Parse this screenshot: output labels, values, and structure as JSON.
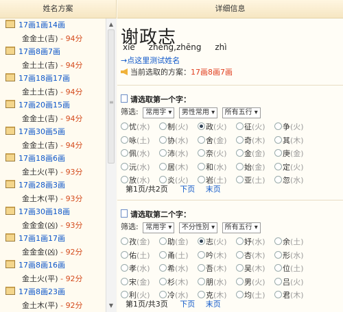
{
  "left_header": "姓名方案",
  "right_header": "详细信息",
  "list": [
    {
      "combo": "17画1画14画",
      "rating": "金金土(吉)",
      "score": "94分"
    },
    {
      "combo": "17画8画7画",
      "rating": "金土土(吉)",
      "score": "94分"
    },
    {
      "combo": "17画18画17画",
      "rating": "金土土(吉)",
      "score": "94分"
    },
    {
      "combo": "17画20画15画",
      "rating": "金金土(吉)",
      "score": "94分"
    },
    {
      "combo": "17画30画5画",
      "rating": "金金土(吉)",
      "score": "94分"
    },
    {
      "combo": "17画18画6画",
      "rating": "金土火(平)",
      "score": "93分"
    },
    {
      "combo": "17画28画3画",
      "rating": "金土木(平)",
      "score": "93分"
    },
    {
      "combo": "17画30画18画",
      "rating": "金金金(凶)",
      "score": "93分"
    },
    {
      "combo": "17画1画17画",
      "rating": "金金金(凶)",
      "score": "92分"
    },
    {
      "combo": "17画8画16画",
      "rating": "金土火(平)",
      "score": "92分"
    },
    {
      "combo": "17画8画23画",
      "rating": "金土木(平)",
      "score": "92分"
    },
    {
      "combo": "17画8画27画",
      "rating": "",
      "score": ""
    }
  ],
  "name": "谢政志",
  "pinyin": [
    "xiè",
    "zhèng,zhēng",
    "zhì"
  ],
  "test_link": "→点这里测试姓名",
  "current_label": "当前选取的方案：",
  "current_value": "17画8画7画",
  "section1": {
    "title": "请选取第一个字：",
    "filter_label": "筛选:",
    "dropdowns": [
      "常用字 ▾",
      "男性常用 ▾",
      "所有五行 ▾"
    ],
    "chars": [
      {
        "c": "忧",
        "e": "(水)"
      },
      {
        "c": "制",
        "e": "(火)"
      },
      {
        "c": "政",
        "e": "(火)",
        "on": true
      },
      {
        "c": "征",
        "e": "(火)"
      },
      {
        "c": "争",
        "e": "(火)"
      },
      {
        "c": "咏",
        "e": "(土)"
      },
      {
        "c": "协",
        "e": "(水)"
      },
      {
        "c": "舍",
        "e": "(金)"
      },
      {
        "c": "奇",
        "e": "(木)"
      },
      {
        "c": "其",
        "e": "(木)"
      },
      {
        "c": "佩",
        "e": "(水)"
      },
      {
        "c": "沛",
        "e": "(水)"
      },
      {
        "c": "奈",
        "e": "(火)"
      },
      {
        "c": "金",
        "e": "(金)"
      },
      {
        "c": "庚",
        "e": "(金)"
      },
      {
        "c": "沅",
        "e": "(水)"
      },
      {
        "c": "居",
        "e": "(木)"
      },
      {
        "c": "和",
        "e": "(水)"
      },
      {
        "c": "始",
        "e": "(金)"
      },
      {
        "c": "定",
        "e": "(火)"
      },
      {
        "c": "放",
        "e": "(水)"
      },
      {
        "c": "炎",
        "e": "(火)"
      },
      {
        "c": "岩",
        "e": "(土)"
      },
      {
        "c": "亚",
        "e": "(土)"
      },
      {
        "c": "忽",
        "e": "(水)"
      }
    ],
    "page": "第1页/共2页",
    "next": "下页",
    "last": "末页"
  },
  "section2": {
    "title": "请选取第二个字：",
    "filter_label": "筛选:",
    "dropdowns": [
      "常用字 ▾",
      "不分性别 ▾",
      "所有五行 ▾"
    ],
    "chars": [
      {
        "c": "孜",
        "e": "(金)"
      },
      {
        "c": "助",
        "e": "(金)"
      },
      {
        "c": "志",
        "e": "(火)",
        "on": true
      },
      {
        "c": "妤",
        "e": "(水)"
      },
      {
        "c": "余",
        "e": "(土)"
      },
      {
        "c": "佑",
        "e": "(土)"
      },
      {
        "c": "甬",
        "e": "(土)"
      },
      {
        "c": "吟",
        "e": "(木)"
      },
      {
        "c": "杏",
        "e": "(木)"
      },
      {
        "c": "形",
        "e": "(水)"
      },
      {
        "c": "孝",
        "e": "(水)"
      },
      {
        "c": "希",
        "e": "(水)"
      },
      {
        "c": "吾",
        "e": "(木)"
      },
      {
        "c": "吴",
        "e": "(木)"
      },
      {
        "c": "位",
        "e": "(土)"
      },
      {
        "c": "宋",
        "e": "(金)"
      },
      {
        "c": "杉",
        "e": "(木)"
      },
      {
        "c": "朋",
        "e": "(水)"
      },
      {
        "c": "男",
        "e": "(火)"
      },
      {
        "c": "吕",
        "e": "(火)"
      },
      {
        "c": "利",
        "e": "(火)"
      },
      {
        "c": "冷",
        "e": "(水)"
      },
      {
        "c": "克",
        "e": "(木)"
      },
      {
        "c": "均",
        "e": "(土)"
      },
      {
        "c": "君",
        "e": "(木)"
      }
    ],
    "page": "第1页/共3页",
    "next": "下页",
    "last": "末页"
  }
}
